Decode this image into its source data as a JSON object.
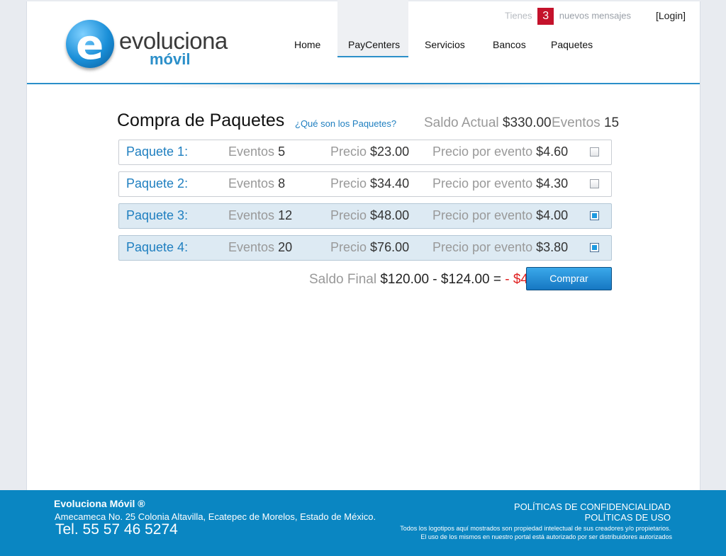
{
  "brand": {
    "logo_letter": "e",
    "name": "evoluciona",
    "sub": "móvil",
    "accent": "#2b8fc9"
  },
  "messages": {
    "prefix": "Tienes",
    "count": "3",
    "suffix": "nuevos mensajes"
  },
  "login_label": "[Login]",
  "nav": [
    {
      "label": "Home",
      "active": false
    },
    {
      "label": "PayCenters",
      "active": true
    },
    {
      "label": "Servicios",
      "active": false
    },
    {
      "label": "Bancos",
      "active": false
    },
    {
      "label": "Paquetes",
      "active": false
    }
  ],
  "content": {
    "title": "Compra de Paquetes",
    "help_link": "¿Qué son los Paquetes?",
    "saldo_label": "Saldo Actual",
    "saldo_value": "$330.00",
    "eventos_label": "Eventos",
    "eventos_value": "15"
  },
  "packages": [
    {
      "name": "Paquete 1:",
      "eventos_label": "Eventos",
      "eventos": "5",
      "precio_label": "Precio",
      "precio": "$23.00",
      "ppe_label": "Precio por evento",
      "ppe": "$4.60",
      "checked": false
    },
    {
      "name": "Paquete 2:",
      "eventos_label": "Eventos",
      "eventos": "8",
      "precio_label": "Precio",
      "precio": "$34.40",
      "ppe_label": "Precio por evento",
      "ppe": "$4.30",
      "checked": false
    },
    {
      "name": "Paquete 3:",
      "eventos_label": "Eventos",
      "eventos": "12",
      "precio_label": "Precio",
      "precio": "$48.00",
      "ppe_label": "Precio por evento",
      "ppe": "$4.00",
      "checked": true
    },
    {
      "name": "Paquete 4:",
      "eventos_label": "Eventos",
      "eventos": "20",
      "precio_label": "Precio",
      "precio": "$76.00",
      "ppe_label": "Precio por evento",
      "ppe": "$3.80",
      "checked": true
    }
  ],
  "summary": {
    "label": "Saldo Final",
    "equation": "$120.00 - $124.00 =",
    "result": "- $4.00"
  },
  "buy_label": "Comprar",
  "footer": {
    "company": "Evoluciona Móvil ®",
    "address": "Amecameca No. 25 Colonia Altavilla, Ecatepec de Morelos, Estado de México.",
    "phone": "Tel. 55 57 46 5274",
    "policy1": "POLÍTICAS DE CONFIDENCIALIDAD",
    "policy2": "POLÍTICAS DE USO",
    "note1": "Todos los logotipos aquí mostrados son propiedad intelectual de sus creadores y/o propietarios.",
    "note2": "El uso de los mismos en nuestro portal está autorizado por ser distribuidores autorizados"
  }
}
